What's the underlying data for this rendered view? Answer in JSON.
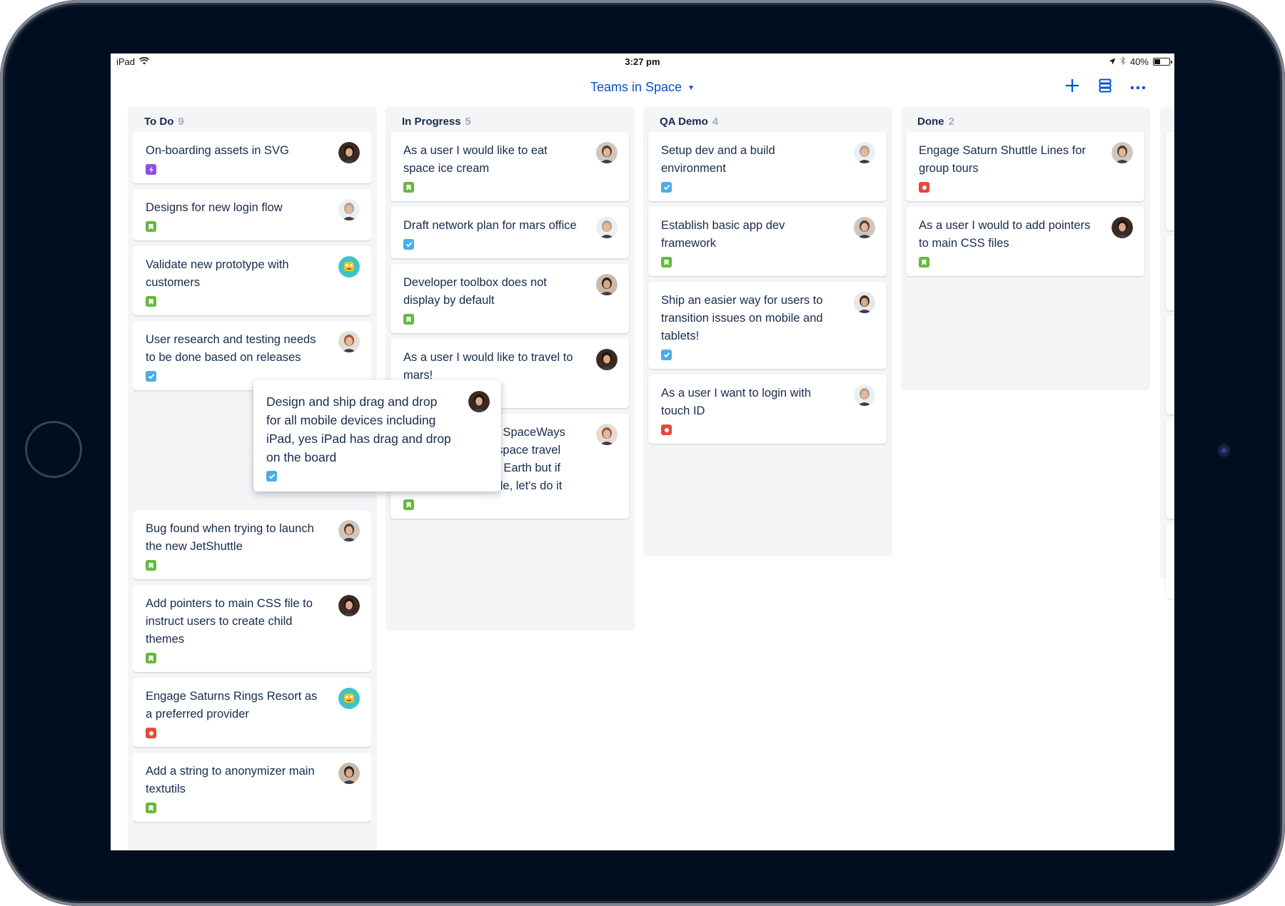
{
  "status_bar": {
    "device": "iPad",
    "time": "3:27 pm",
    "battery": "40%",
    "battery_level": 0.4
  },
  "header": {
    "board_title": "Teams in Space",
    "icons": [
      "plus-icon",
      "board-settings-icon",
      "more-icon"
    ]
  },
  "colors": {
    "accent": "#0052cc",
    "story": "#63ba3c",
    "task": "#4bade8",
    "bug": "#e5493a",
    "epic": "#904ee2",
    "column_bg": "#f4f5f7",
    "text": "#172b4d"
  },
  "columns": [
    {
      "name": "To Do",
      "count": "9",
      "cards": [
        {
          "title": "On-boarding assets in SVG",
          "type": "epic",
          "avatar": "woman-dark-hair"
        },
        {
          "title": "Designs for new login flow",
          "type": "story",
          "avatar": "man-grey-shirt"
        },
        {
          "title": "Validate new prototype with customers",
          "type": "story",
          "avatar": "robot-teal"
        },
        {
          "title": "User research and testing needs to be done based on releases",
          "type": "task",
          "avatar": "man-beard-glasses"
        },
        {
          "title": "Bug found when trying to launch the new  JetShuttle",
          "type": "story",
          "avatar": "woman-brown-hair"
        },
        {
          "title": "Add pointers to main CSS file to instruct users to create child themes",
          "type": "story",
          "avatar": "woman-dark-hair"
        },
        {
          "title": "Engage Saturns Rings Resort as a preferred provider",
          "type": "bug",
          "avatar": "robot-teal"
        },
        {
          "title": "Add a string to anonymizer main textutils",
          "type": "story",
          "avatar": "man-dark-shirt"
        }
      ]
    },
    {
      "name": "In Progress",
      "count": "5",
      "cards": [
        {
          "title": "As a user I would like to eat space ice cream",
          "type": "story",
          "avatar": "woman-brown-hair"
        },
        {
          "title": "Draft network plan for mars office",
          "type": "task",
          "avatar": "man-grey-shirt"
        },
        {
          "title": "Developer toolbox does not display by default",
          "type": "story",
          "avatar": "man-dark-shirt"
        },
        {
          "title": "As a user I would like to travel to mars!",
          "type": "task",
          "avatar": "woman-dark-hair"
        },
        {
          "title": "Engage JetShuttle SpaceWays for short distance space travel between Mars and Earth but if Saturn is achievable, let's do it",
          "type": "story",
          "avatar": "man-beard-glasses"
        }
      ]
    },
    {
      "name": "QA Demo",
      "count": "4",
      "cards": [
        {
          "title": "Setup dev and a build environment",
          "type": "task",
          "avatar": "man-grey-shirt"
        },
        {
          "title": "Establish basic app dev framework",
          "type": "story",
          "avatar": "woman-brown-hair"
        },
        {
          "title": "Ship an easier way for users to transition issues on mobile and tablets!",
          "type": "task",
          "avatar": "man-jacket"
        },
        {
          "title": "As a user I want to login with touch ID",
          "type": "bug",
          "avatar": "man-grey-shirt"
        }
      ]
    },
    {
      "name": "Done",
      "count": "2",
      "cards": [
        {
          "title": "Engage Saturn Shuttle Lines for group tours",
          "type": "bug",
          "avatar": "woman-brown-hair"
        },
        {
          "title": "As a user I would to add pointers to main CSS files",
          "type": "story",
          "avatar": "woman-dark-hair"
        }
      ]
    }
  ],
  "dragged_card": {
    "title": "Design and ship drag and drop for all mobile devices including iPad, yes iPad has drag and drop on the board",
    "type": "task",
    "avatar": "woman-dark-hair"
  }
}
